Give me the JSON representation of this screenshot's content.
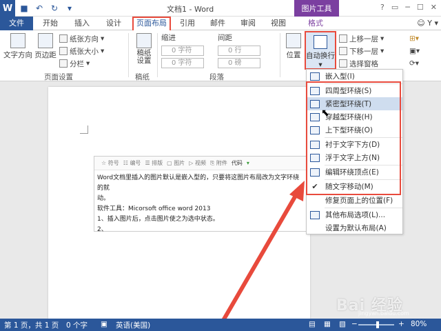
{
  "titlebar": {
    "title": "文档1 - Word",
    "context_tool": "图片工具",
    "controls": [
      "?",
      "▭",
      "─",
      "☐",
      "✕"
    ]
  },
  "tabs": [
    "文件",
    "开始",
    "插入",
    "设计",
    "页面布局",
    "引用",
    "邮件",
    "审阅",
    "视图",
    "格式"
  ],
  "active_tab": "页面布局",
  "account": "Y",
  "ribbon": {
    "text_direction": "文字方向",
    "margins": "页边距",
    "orientation": "纸张方向",
    "size": "纸张大小",
    "columns": "分栏",
    "page_setup_label": "页面设置",
    "draft_paper": "稿纸\n设置",
    "draft_label": "稿纸",
    "indent_label": "缩进",
    "spacing_label": "间距",
    "left_indent": "0 字符",
    "right_indent": "0 字符",
    "before_spacing": "0 行",
    "after_spacing": "0 磅",
    "paragraph_label": "段落",
    "position": "位置",
    "auto_wrap": "自动换行",
    "bring_forward": "上移一层",
    "send_backward": "下移一层",
    "selection_pane": "选择窗格"
  },
  "wrap_menu": {
    "items": [
      {
        "label": "嵌入型(I)",
        "icon": "inline-wrap-icon"
      },
      {
        "label": "四周型环绕(S)",
        "icon": "square-wrap-icon"
      },
      {
        "label": "紧密型环绕(T)",
        "icon": "tight-wrap-icon"
      },
      {
        "label": "穿越型环绕(H)",
        "icon": "through-wrap-icon"
      },
      {
        "label": "上下型环绕(O)",
        "icon": "top-bottom-wrap-icon"
      },
      {
        "label": "衬于文字下方(D)",
        "icon": "behind-text-icon"
      },
      {
        "label": "浮于文字上方(N)",
        "icon": "in-front-text-icon"
      },
      {
        "label": "编辑环绕顶点(E)",
        "icon": "edit-wrap-points-icon"
      },
      {
        "label": "随文字移动(M)",
        "icon": "check-icon"
      },
      {
        "label": "修复页面上的位置(F)",
        "icon": ""
      },
      {
        "label": "其他布局选项(L)...",
        "icon": "layout-options-icon"
      },
      {
        "label": "设置为默认布局(A)",
        "icon": ""
      }
    ],
    "highlighted": "紧密型环绕(T)"
  },
  "image_content": {
    "toolbar": [
      "符号",
      "编号",
      "排版",
      "图片",
      "视频",
      "附件",
      "代码"
    ],
    "code_dropdown": "▾",
    "lines": [
      "Word文档里插入的图片默认是嵌入型的，只要将这图片布局改为文字环绕的就",
      "动。",
      "软件工具：Micorsoft office word 2013",
      "1、插入图片后，点击图片使之为选中状态。",
      "2、"
    ]
  },
  "status": {
    "page": "第 1 页，共 1 页",
    "words": "0 个字",
    "language": "英语(美国)",
    "zoom": "80%"
  },
  "watermark": {
    "text": "Bai 经验",
    "url": "jingyan.baidu.com"
  },
  "colors": {
    "brand": "#2b579a",
    "context": "#7b3fa0",
    "highlight_border": "#e84a3c",
    "menu_highlight": "#cfddef"
  }
}
